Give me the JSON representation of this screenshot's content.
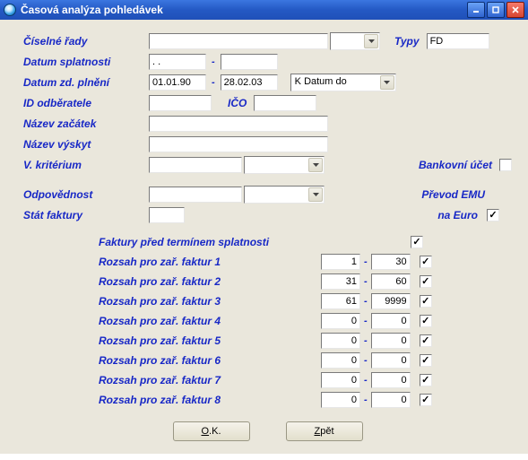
{
  "window": {
    "title": "Časová analýza pohledávek"
  },
  "labels": {
    "ciselne_rady": "Číselné řady",
    "typy": "Typy",
    "datum_splatnosti": "Datum splatnosti",
    "datum_zd_plneni": "Datum zd. plnění",
    "id_odberatele": "ID odběratele",
    "ico": "IČO",
    "nazev_zacatek": "Název začátek",
    "nazev_vyskyt": "Název výskyt",
    "v_kriterium": "V. kritérium",
    "bankovni_ucet": "Bankovní účet",
    "odpovednost": "Odpovědnost",
    "stat_faktury": "Stát faktury",
    "prevod_emu1": "Převod EMU",
    "prevod_emu2": "na Euro",
    "faktury_pred": "Faktury před termínem splatnosti",
    "rozsah_prefix": "Rozsah pro zař. faktur ",
    "dash": "-"
  },
  "values": {
    "typy": "FD",
    "splatnost_from": ". .",
    "splatnost_to": "",
    "zd_from": "01.01.90",
    "zd_to": "28.02.03",
    "k_datum": "K Datum do",
    "id_odberatele": "",
    "ico": "",
    "nazev_zacatek": "",
    "nazev_vyskyt": "",
    "v_kriterium": "",
    "odpovednost": "",
    "stat_faktury": ""
  },
  "checks": {
    "bankovni_ucet": false,
    "prevod_emu": true,
    "faktury_pred": true
  },
  "ranges": [
    {
      "n": "1",
      "from": "1",
      "to": "30",
      "checked": true
    },
    {
      "n": "2",
      "from": "31",
      "to": "60",
      "checked": true
    },
    {
      "n": "3",
      "from": "61",
      "to": "9999",
      "checked": true
    },
    {
      "n": "4",
      "from": "0",
      "to": "0",
      "checked": true
    },
    {
      "n": "5",
      "from": "0",
      "to": "0",
      "checked": true
    },
    {
      "n": "6",
      "from": "0",
      "to": "0",
      "checked": true
    },
    {
      "n": "7",
      "from": "0",
      "to": "0",
      "checked": true
    },
    {
      "n": "8",
      "from": "0",
      "to": "0",
      "checked": true
    }
  ],
  "buttons": {
    "ok": "O.K.",
    "back": "Zpět"
  }
}
